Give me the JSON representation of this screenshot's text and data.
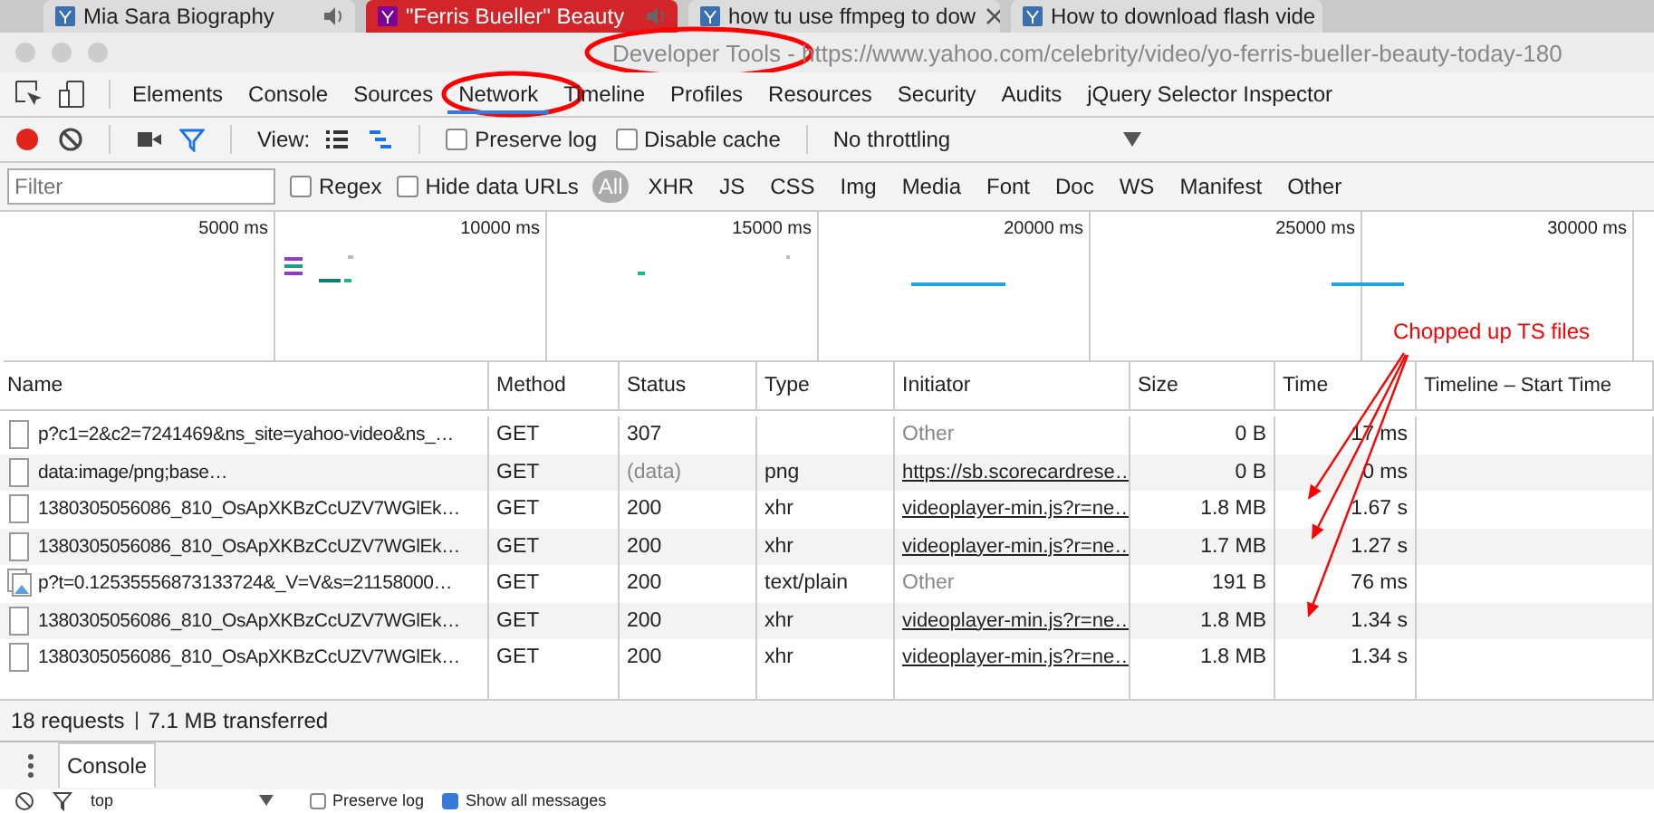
{
  "browser_tabs": [
    {
      "title": "Mia Sara Biography",
      "selected": false
    },
    {
      "title": "\"Ferris Bueller\" Beauty",
      "selected": true
    },
    {
      "title": "how tu use ffmpeg to dow",
      "selected": false
    },
    {
      "title": "How to download flash vide",
      "selected": false
    }
  ],
  "window": {
    "title": "Developer Tools - https://www.yahoo.com/celebrity/video/yo-ferris-bueller-beauty-today-180"
  },
  "panel_tabs": [
    {
      "label": "Elements",
      "selected": false
    },
    {
      "label": "Console",
      "selected": false
    },
    {
      "label": "Sources",
      "selected": false
    },
    {
      "label": "Network",
      "selected": true
    },
    {
      "label": "Timeline",
      "selected": false
    },
    {
      "label": "Profiles",
      "selected": false
    },
    {
      "label": "Resources",
      "selected": false
    },
    {
      "label": "Security",
      "selected": false
    },
    {
      "label": "Audits",
      "selected": false
    },
    {
      "label": "jQuery Selector Inspector",
      "selected": false
    }
  ],
  "toolbar": {
    "recording": true,
    "view_label": "View:",
    "preserve_log": {
      "label": "Preserve log",
      "checked": false
    },
    "disable_cache": {
      "label": "Disable cache",
      "checked": false
    },
    "throttling": "No throttling"
  },
  "filter_bar": {
    "placeholder": "Filter",
    "regex": {
      "label": "Regex",
      "checked": false
    },
    "hide_data_urls": {
      "label": "Hide data URLs",
      "checked": false
    },
    "types": [
      {
        "label": "All",
        "selected": true
      },
      {
        "label": "XHR",
        "selected": false
      },
      {
        "label": "JS",
        "selected": false
      },
      {
        "label": "CSS",
        "selected": false
      },
      {
        "label": "Img",
        "selected": false
      },
      {
        "label": "Media",
        "selected": false
      },
      {
        "label": "Font",
        "selected": false
      },
      {
        "label": "Doc",
        "selected": false
      },
      {
        "label": "WS",
        "selected": false
      },
      {
        "label": "Manifest",
        "selected": false
      },
      {
        "label": "Other",
        "selected": false
      }
    ]
  },
  "overview": {
    "ticks": [
      "5000 ms",
      "10000 ms",
      "15000 ms",
      "20000 ms",
      "25000 ms",
      "30000 ms"
    ]
  },
  "table": {
    "columns": [
      "Name",
      "Method",
      "Status",
      "Type",
      "Initiator",
      "Size",
      "Time",
      "Timeline – Start Time"
    ],
    "rows": [
      {
        "kind": "file",
        "name": "p?c1=2&c2=7241469&ns_site=yahoo-video&ns_…",
        "method": "GET",
        "status": "307",
        "status_dim": false,
        "type": "",
        "initiator": "Other",
        "initiator_link": false,
        "size": "0 B",
        "time": "17 ms"
      },
      {
        "kind": "file",
        "name": "data:image/png;base…",
        "method": "GET",
        "status": "(data)",
        "status_dim": true,
        "type": "png",
        "initiator": "https://sb.scorecardrese…",
        "initiator_link": true,
        "size": "0 B",
        "time": "0 ms"
      },
      {
        "kind": "file",
        "name": "1380305056086_810_OsApXKBzCcUZV7WGlEk…",
        "method": "GET",
        "status": "200",
        "status_dim": false,
        "type": "xhr",
        "initiator": "videoplayer-min.js?r=ne…",
        "initiator_link": true,
        "size": "1.8 MB",
        "time": "1.67 s"
      },
      {
        "kind": "file",
        "name": "1380305056086_810_OsApXKBzCcUZV7WGlEk…",
        "method": "GET",
        "status": "200",
        "status_dim": false,
        "type": "xhr",
        "initiator": "videoplayer-min.js?r=ne…",
        "initiator_link": true,
        "size": "1.7 MB",
        "time": "1.27 s"
      },
      {
        "kind": "image",
        "name": "p?t=0.12535556873133724&_V=V&s=21158000…",
        "method": "GET",
        "status": "200",
        "status_dim": false,
        "type": "text/plain",
        "initiator": "Other",
        "initiator_link": false,
        "size": "191 B",
        "time": "76 ms"
      },
      {
        "kind": "file",
        "name": "1380305056086_810_OsApXKBzCcUZV7WGlEk…",
        "method": "GET",
        "status": "200",
        "status_dim": false,
        "type": "xhr",
        "initiator": "videoplayer-min.js?r=ne…",
        "initiator_link": true,
        "size": "1.8 MB",
        "time": "1.34 s"
      },
      {
        "kind": "file",
        "name": "1380305056086_810_OsApXKBzCcUZV7WGlEk…",
        "method": "GET",
        "status": "200",
        "status_dim": false,
        "type": "xhr",
        "initiator": "videoplayer-min.js?r=ne…",
        "initiator_link": true,
        "size": "1.8 MB",
        "time": "1.34 s"
      }
    ]
  },
  "status_bar": {
    "requests": "18 requests",
    "transferred": "7.1 MB transferred"
  },
  "drawer": {
    "tabs": [
      {
        "label": "Console",
        "selected": true
      }
    ],
    "context": "top",
    "preserve_log": {
      "label": "Preserve log",
      "checked": false
    },
    "show_all": {
      "label": "Show all messages",
      "checked": true
    }
  },
  "annotation": {
    "text": "Chopped up TS files"
  }
}
